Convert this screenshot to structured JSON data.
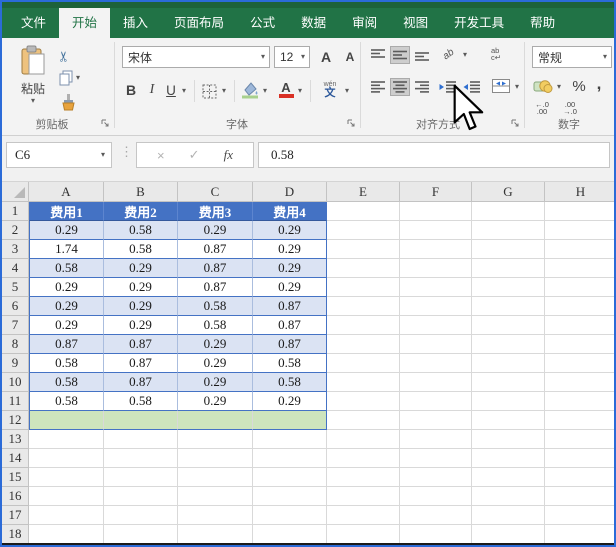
{
  "tabs": [
    {
      "label": "文件"
    },
    {
      "label": "开始"
    },
    {
      "label": "插入"
    },
    {
      "label": "页面布局"
    },
    {
      "label": "公式"
    },
    {
      "label": "数据"
    },
    {
      "label": "审阅"
    },
    {
      "label": "视图"
    },
    {
      "label": "开发工具"
    },
    {
      "label": "帮助"
    }
  ],
  "icons": {
    "caret": "▾",
    "up_triangle": "▲",
    "down_triangle": "▼",
    "scissors": "✂",
    "dots": "⋮",
    "left_arrow": "◄",
    "right_arrow": "►"
  },
  "ribbon": {
    "clipboard": {
      "paste_label": "粘贴",
      "group_label": "剪贴板"
    },
    "font": {
      "font_name": "宋体",
      "font_size": "12",
      "bold": "B",
      "italic": "I",
      "underline": "U",
      "grow_font": "A",
      "shrink_font": "A",
      "font_color_letter": "A",
      "phonetic_top": "wén",
      "phonetic_bottom": "文",
      "group_label": "字体"
    },
    "alignment": {
      "orientation_label": "ab",
      "wrap_line1": "ab",
      "wrap_line2": "c↵",
      "group_label": "对齐方式"
    },
    "number": {
      "format": "常规",
      "percent": "%",
      "comma": ",",
      "inc_top": "←.0",
      "inc_bottom": ".00",
      "dec_top": ".00",
      "dec_bottom": "→.0",
      "group_label": "数字"
    }
  },
  "formula_bar": {
    "name_box": "C6",
    "cancel": "×",
    "enter": "✓",
    "fx": "fx",
    "value": "0.58"
  },
  "sheet": {
    "col_headers": [
      "A",
      "B",
      "C",
      "D",
      "E",
      "F",
      "G",
      "H"
    ],
    "row_count": 18,
    "table": {
      "headers": [
        "费用1",
        "费用2",
        "费用3",
        "费用4"
      ],
      "rows": [
        [
          "0.29",
          "0.58",
          "0.29",
          "0.29"
        ],
        [
          "1.74",
          "0.58",
          "0.87",
          "0.29"
        ],
        [
          "0.58",
          "0.29",
          "0.87",
          "0.29"
        ],
        [
          "0.29",
          "0.29",
          "0.87",
          "0.29"
        ],
        [
          "0.29",
          "0.29",
          "0.58",
          "0.87"
        ],
        [
          "0.29",
          "0.29",
          "0.58",
          "0.87"
        ],
        [
          "0.87",
          "0.87",
          "0.29",
          "0.87"
        ],
        [
          "0.58",
          "0.87",
          "0.29",
          "0.58"
        ],
        [
          "0.58",
          "0.87",
          "0.29",
          "0.58"
        ],
        [
          "0.58",
          "0.58",
          "0.29",
          "0.29"
        ]
      ],
      "green_row": 12
    },
    "colors": {
      "header_fill": "#4472c4",
      "band_fill": "#dbe3f3",
      "green_fill": "#cde4bd",
      "table_border": "#4472c4"
    },
    "selected_cell": "C6"
  }
}
